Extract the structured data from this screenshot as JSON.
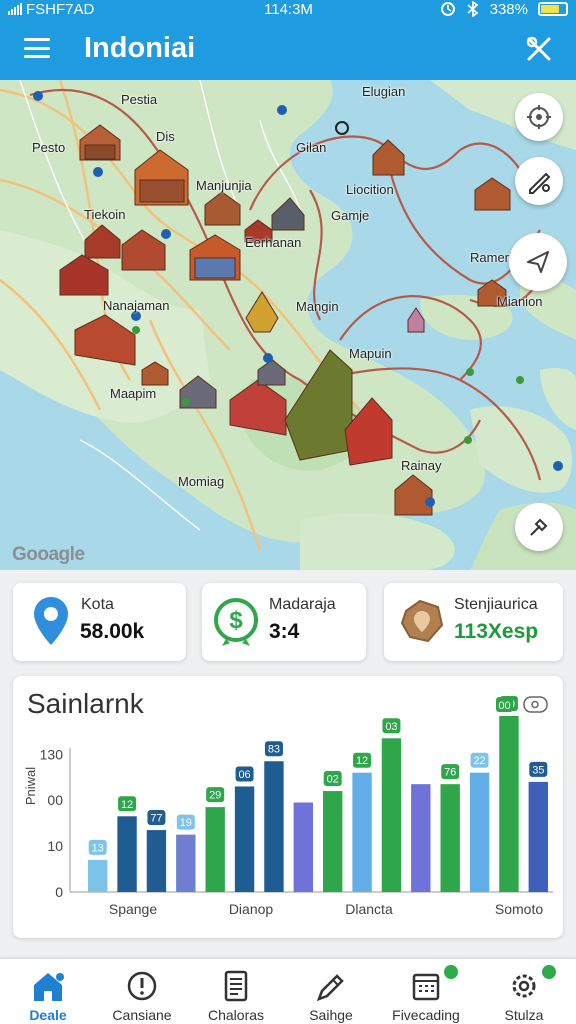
{
  "status_bar": {
    "carrier": "FSHF7AD",
    "time": "114:3M",
    "battery": "338%"
  },
  "app_bar": {
    "title": "Indoniai"
  },
  "map": {
    "labels": [
      "Pestia",
      "Elugian",
      "Pesto",
      "Dis",
      "Gilan",
      "Manjunjia",
      "Liocition",
      "Tiekoin",
      "Gamje",
      "Eerhanan",
      "Rameri",
      "Nanajaman",
      "Mangin",
      "Mianion",
      "Mapuin",
      "Maapim",
      "Rainay",
      "Momiag"
    ],
    "watermark": "Gooagle",
    "controls": [
      "target-icon",
      "pen-icon",
      "navigate-icon",
      "tool-icon"
    ]
  },
  "stats": [
    {
      "label": "Kota",
      "value": "58.00k",
      "icon": "location-pin-icon",
      "value_color": "#111111"
    },
    {
      "label": "Madaraja",
      "value": "3:4",
      "icon": "dollar-badge-icon",
      "value_color": "#111111"
    },
    {
      "label": "Stenjiaurica",
      "value": "113Xesp",
      "icon": "map-badge-icon",
      "value_color": "#1d9a3a"
    }
  ],
  "chart_data": {
    "type": "bar",
    "title": "Sainlarnk",
    "ylabel": "Pniwal",
    "y_ticks": [
      "0",
      "10",
      "00",
      "130"
    ],
    "tick_values": [
      0,
      10,
      20,
      30
    ],
    "ylim": [
      0,
      34
    ],
    "legend_text": "00",
    "x_labels": [
      "Spange",
      "Dianop",
      "Dlancta",
      "Somoto"
    ],
    "values": [
      7,
      16.5,
      13.5,
      12.5,
      18.5,
      23,
      28.5,
      19.5,
      22,
      26,
      33.5,
      23.5,
      23.5,
      26,
      39,
      24
    ],
    "colors": [
      "#7ec3ea",
      "#1f5c92",
      "#1f5c92",
      "#6f7ed0",
      "#2fa64a",
      "#1f5c92",
      "#1f5c92",
      "#6f72d8",
      "#2fa64a",
      "#62aee8",
      "#2fa64a",
      "#6f72d8",
      "#2fa64a",
      "#62aee8",
      "#2fa64a",
      "#3d60b8"
    ],
    "data_labels": [
      "13",
      "12",
      "77",
      "19",
      "29",
      "06",
      "83",
      "",
      "02",
      "12",
      "03",
      "",
      "76",
      "22",
      "00",
      "35"
    ],
    "label_colors": [
      "#7ec3ea",
      "#2fa64a",
      "#1f5c92",
      "#7ec3ea",
      "#2fa64a",
      "#1f5c92",
      "#1f5c92",
      "",
      "#2fa64a",
      "#2fa64a",
      "#2fa64a",
      "",
      "#2fa64a",
      "#7ec3ea",
      "#2fa64a",
      "#1f5c92"
    ]
  },
  "bottom_nav": [
    {
      "label": "Deale",
      "icon": "home-icon",
      "active": true,
      "badge": false
    },
    {
      "label": "Cansiane",
      "icon": "alert-icon",
      "active": false,
      "badge": false
    },
    {
      "label": "Chaloras",
      "icon": "document-icon",
      "active": false,
      "badge": false
    },
    {
      "label": "Saihge",
      "icon": "pen-icon",
      "active": false,
      "badge": false
    },
    {
      "label": "Fivecading",
      "icon": "calendar-icon",
      "active": false,
      "badge": true
    },
    {
      "label": "Stulza",
      "icon": "settings-icon",
      "active": false,
      "badge": true
    }
  ]
}
